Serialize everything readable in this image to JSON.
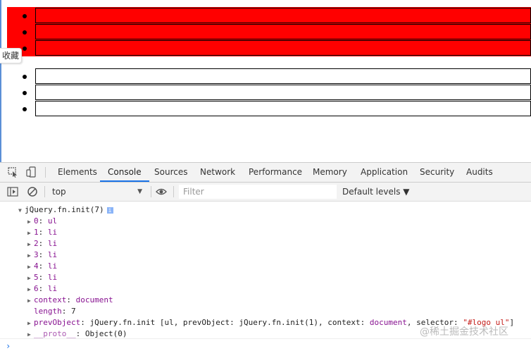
{
  "page": {
    "favorite_tab": "收藏"
  },
  "devtools": {
    "tabs": [
      "Elements",
      "Console",
      "Sources",
      "Network",
      "Performance",
      "Memory",
      "Application",
      "Security",
      "Audits"
    ],
    "active_tab": "Console",
    "toolbar": {
      "context": "top",
      "filter_placeholder": "Filter",
      "levels": "Default levels ▼"
    },
    "console": {
      "root": "jQuery.fn.init(7)",
      "info_badge": "i",
      "items": [
        {
          "key": "0",
          "value": "ul"
        },
        {
          "key": "1",
          "value": "li"
        },
        {
          "key": "2",
          "value": "li"
        },
        {
          "key": "3",
          "value": "li"
        },
        {
          "key": "4",
          "value": "li"
        },
        {
          "key": "5",
          "value": "li"
        },
        {
          "key": "6",
          "value": "li"
        }
      ],
      "context_key": "context",
      "context_val": "document",
      "length_key": "length",
      "length_val": "7",
      "prevobject_key": "prevObject",
      "prevobject_val_a": "jQuery.fn.init [ul, prevObject: jQuery.fn.init(1), context: ",
      "prevobject_val_doc": "document",
      "prevobject_val_b": ", selector: ",
      "prevobject_selector": "\"#logo ul\"",
      "prevobject_end": "]",
      "proto_key": "__proto__",
      "proto_val": "Object(0)",
      "prompt": "›"
    }
  },
  "watermark": "@稀土掘金技术社区"
}
